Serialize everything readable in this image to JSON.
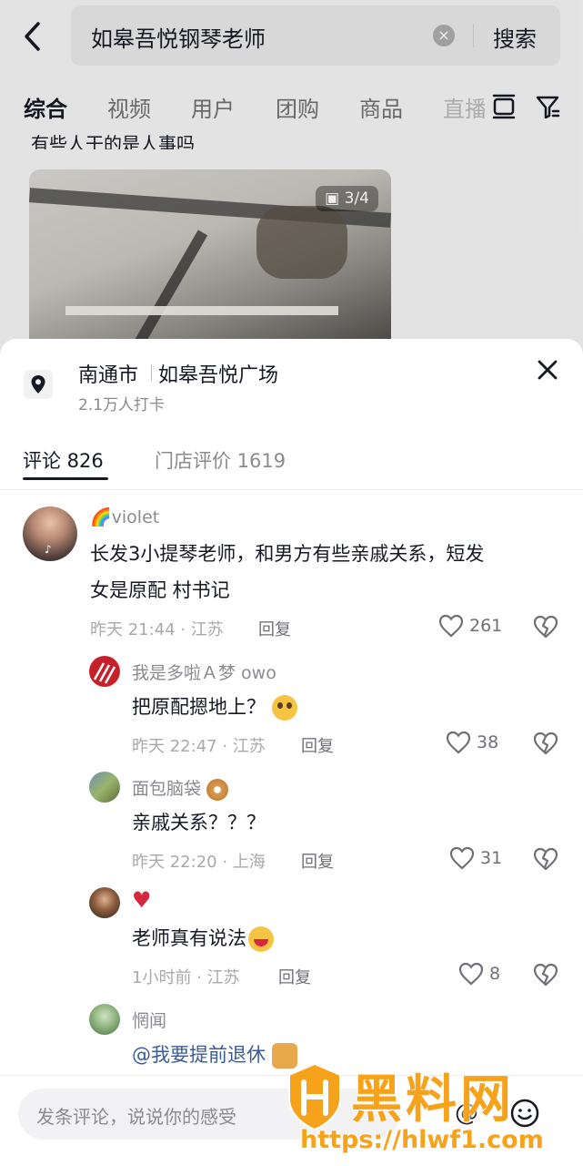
{
  "search": {
    "query": "如皋吾悦钢琴老师",
    "button_label": "搜索"
  },
  "top_tabs": [
    {
      "label": "综合",
      "active": true
    },
    {
      "label": "视频"
    },
    {
      "label": "用户"
    },
    {
      "label": "团购"
    },
    {
      "label": "商品"
    },
    {
      "label": "直播"
    }
  ],
  "post": {
    "caption": "有些人干的是人事吗",
    "image_counter": "3/4"
  },
  "location": {
    "city": "南通市",
    "place": "如皋吾悦广场",
    "checkins": "2.1万人打卡"
  },
  "sheet_tabs": [
    {
      "label": "评论 826",
      "active": true
    },
    {
      "label": "门店评价 1619"
    }
  ],
  "comments": [
    {
      "user": "🌈violet",
      "text_line1": "长发3小提琴老师，和男方有些亲戚关系，短发",
      "text_line2": "女是原配 村书记",
      "time": "昨天 21:44 · 江苏",
      "reply_label": "回复",
      "likes": "261"
    },
    {
      "user": "我是多啦Ａ梦 owo",
      "text": "把原配摁地上？",
      "time": "昨天 22:47 · 江苏",
      "reply_label": "回复",
      "likes": "38"
    },
    {
      "user": "面包脑袋",
      "text": "亲戚关系？？？",
      "time": "昨天 22:20 · 上海",
      "reply_label": "回复",
      "likes": "31"
    },
    {
      "user": "♥",
      "text": "老师真有说法",
      "time": "1小时前 · 江苏",
      "reply_label": "回复",
      "likes": "8"
    },
    {
      "user": "惘闻",
      "text": "@我要提前退休"
    }
  ],
  "input": {
    "placeholder": "发条评论，说说你的感受"
  },
  "watermark": {
    "title": "黑料网",
    "url": "https://hlwf1.com"
  },
  "colors": {
    "watermark": "#f7a21b",
    "like_red": "#d7263d"
  }
}
